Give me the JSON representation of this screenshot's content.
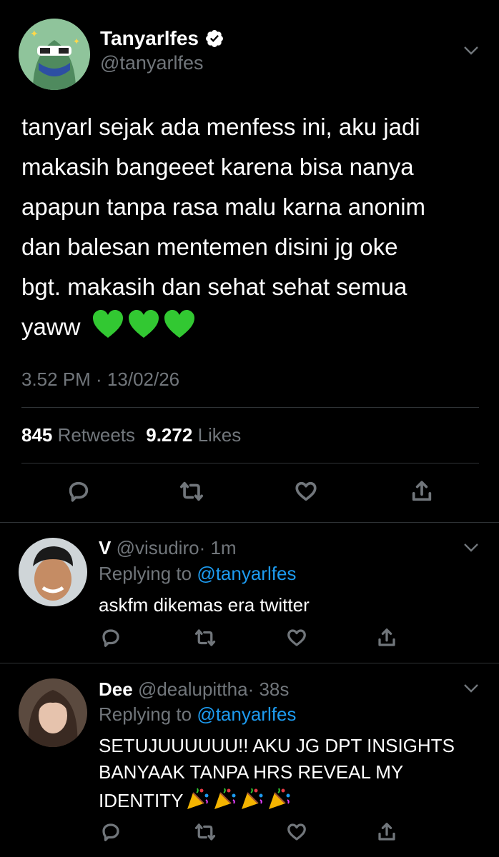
{
  "main_tweet": {
    "display_name": "Tanyarlfes",
    "handle": "@tanyarlfes",
    "verified": true,
    "text_lines": [
      "tanyarl sejak ada menfess ini, aku jadi",
      "makasih bangeeet karena bisa nanya",
      "apapun tanpa rasa malu karna anonim",
      "dan balesan mentemen disini jg oke",
      "bgt. makasih dan sehat sehat semua",
      "yaww"
    ],
    "emoji": "green-heart x3",
    "timestamp": "3.52 PM · 13/02/26",
    "retweets_count": "845",
    "retweets_label": "Retweets",
    "likes_count": "9.272",
    "likes_label": "Likes"
  },
  "replies": [
    {
      "display_name": "V",
      "handle": "@visudiro",
      "time": "· 1m",
      "replying_prefix": "Replying to",
      "replying_handle": "@tanyarlfes",
      "text_lines": [
        "askfm dikemas era twitter"
      ]
    },
    {
      "display_name": "Dee",
      "handle": "@dealupittha",
      "time": "· 38s",
      "replying_prefix": "Replying to",
      "replying_handle": "@tanyarlfes",
      "text_lines": [
        "SETUJUUUUUU!! AKU JG DPT INSIGHTS",
        "BANYAAK TANPA HRS REVEAL MY",
        "IDENTITY"
      ],
      "emoji": "party-popper x4"
    }
  ],
  "icons": [
    "verified-badge-icon",
    "chevron-down-icon",
    "reply-icon",
    "retweet-icon",
    "like-icon",
    "share-icon",
    "green-heart-icon",
    "party-popper-icon"
  ],
  "colors": {
    "background": "#000000",
    "text": "#ffffff",
    "muted": "#71767b",
    "link": "#1d9bf0",
    "verified": "#ffffff",
    "heart": "#32c832"
  }
}
